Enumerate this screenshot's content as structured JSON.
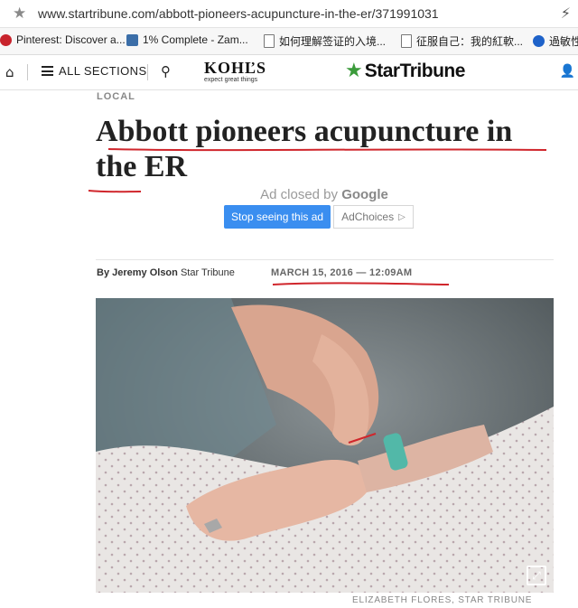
{
  "browser": {
    "url": "www.startribune.com/abbott-pioneers-acupuncture-in-the-er/371991031",
    "bookmarks": [
      {
        "label": "Pinterest: Discover a...",
        "icon": "pinterest-icon"
      },
      {
        "label": "1% Complete - Zam...",
        "icon": "zamzar-icon"
      },
      {
        "label": "如何理解签证的入境...",
        "icon": "page-icon"
      },
      {
        "label": "征服自己：我的紅軟...",
        "icon": "page-icon"
      },
      {
        "label": "過敏性",
        "icon": "globe-icon"
      }
    ]
  },
  "site": {
    "menu_label": "ALL SECTIONS",
    "sponsor": {
      "name": "KOHĽS",
      "tagline": "expect great things"
    },
    "logo_text": "StarTribune"
  },
  "article": {
    "section": "LOCAL",
    "headline": "Abbott pioneers acupuncture in the ER",
    "author": "By Jeremy Olson",
    "publication": "Star Tribune",
    "date": "MARCH 15, 2016 — 12:09AM",
    "photo_credit": "ELIZABETH FLORES, STAR TRIBUNE"
  },
  "ad": {
    "closed_prefix": "Ad closed by",
    "closed_brand": "Google",
    "stop_label": "Stop seeing this ad",
    "choices_label": "AdChoices"
  },
  "colors": {
    "accent": "#3a8ef0",
    "logo_star": "#3b9b3b",
    "annotation_ink": "#d0262c"
  }
}
